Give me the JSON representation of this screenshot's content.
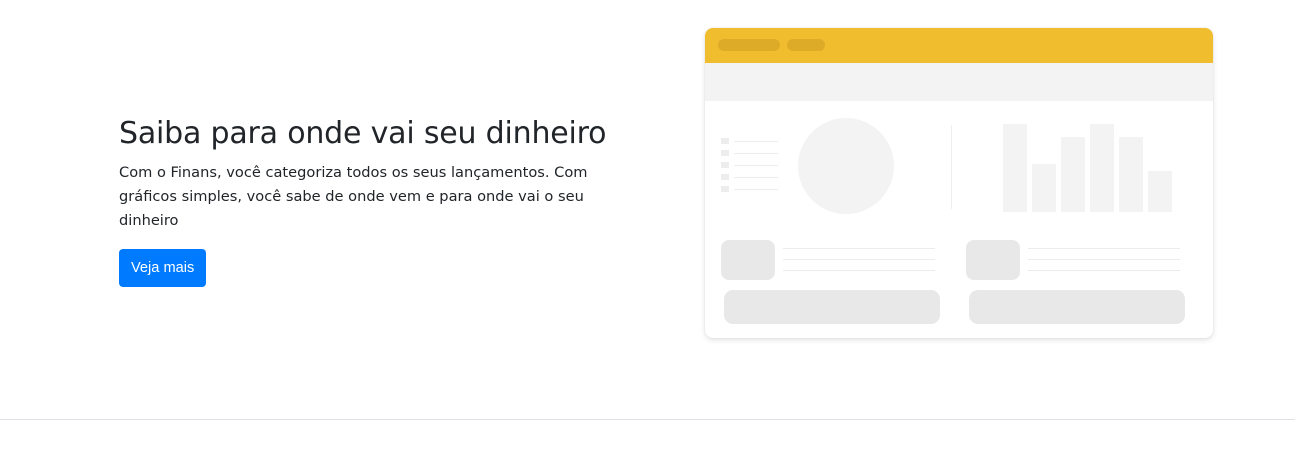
{
  "hero": {
    "title": "Saiba para onde vai seu dinheiro",
    "description": "Com o Finans, você categoriza todos os seus lançamentos. Com gráficos simples, você sabe de onde vem e para onde vai o seu dinheiro",
    "cta_label": "Veja mais"
  },
  "colors": {
    "primary": "#007bff",
    "illustration_accent": "#f0bd2f",
    "text": "#212529",
    "placeholder": "#e8e8e8"
  },
  "illustration": {
    "icon": "dashboard-preview-illustration",
    "bar_chart_relative_heights": [
      1.0,
      0.55,
      0.85,
      1.0,
      0.85,
      0.47
    ]
  }
}
